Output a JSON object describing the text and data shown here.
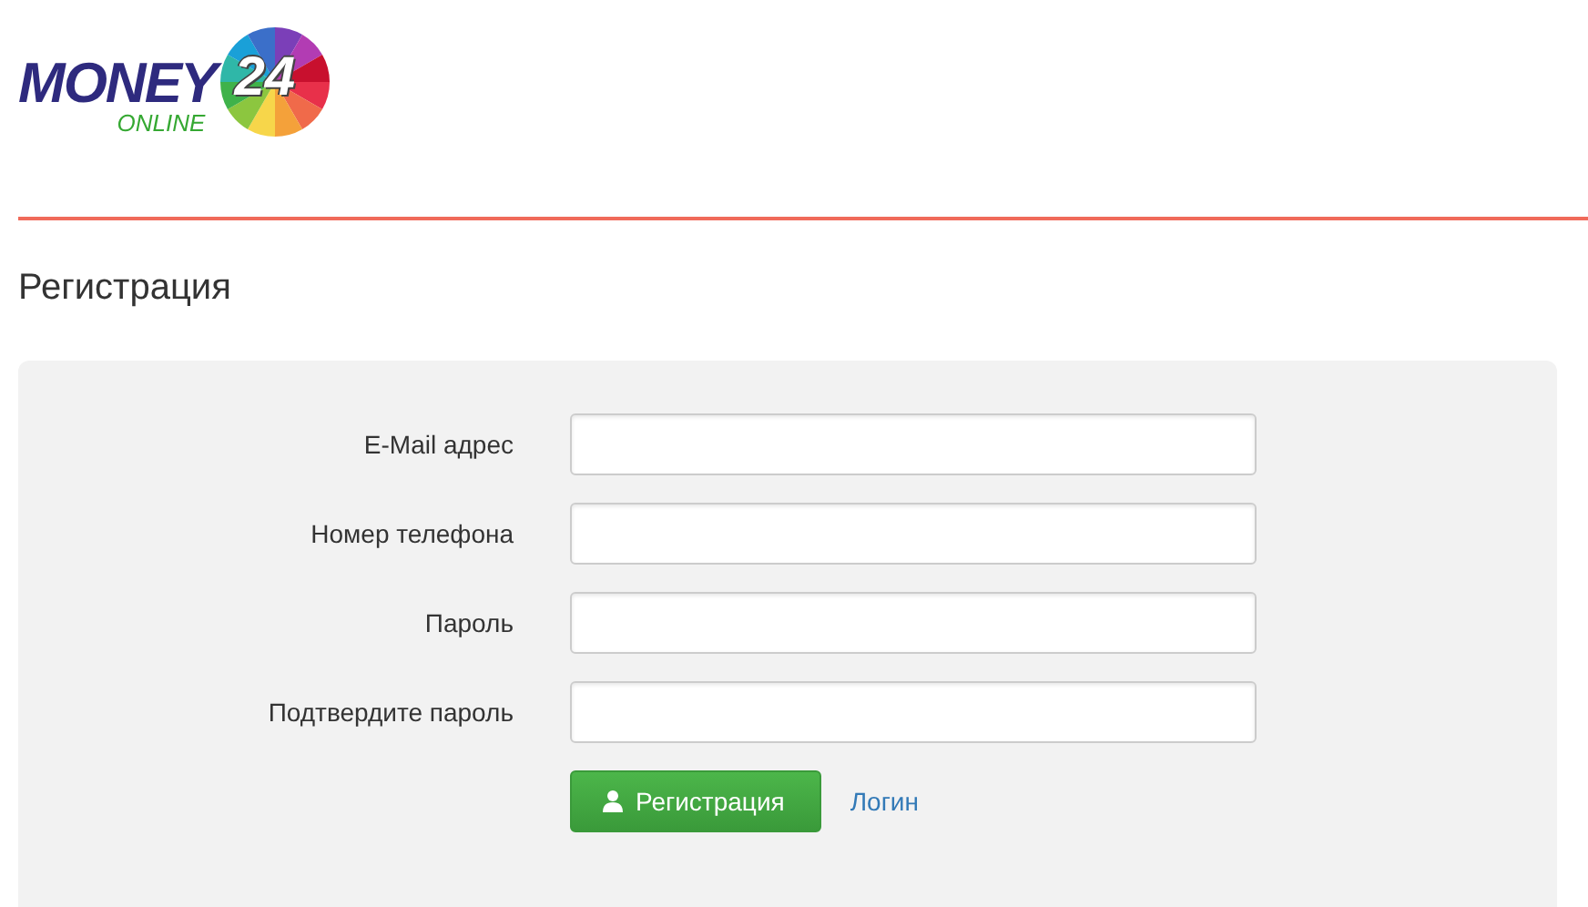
{
  "logo": {
    "word": "MONEY",
    "number": "24",
    "tagline": "ONLINE"
  },
  "page_title": "Регистрация",
  "form": {
    "fields": [
      {
        "label": "E-Mail адрес"
      },
      {
        "label": "Номер телефона"
      },
      {
        "label": "Пароль"
      },
      {
        "label": "Подтвердите пароль"
      }
    ],
    "submit_button": "Регистрация",
    "login_link": "Логин"
  }
}
